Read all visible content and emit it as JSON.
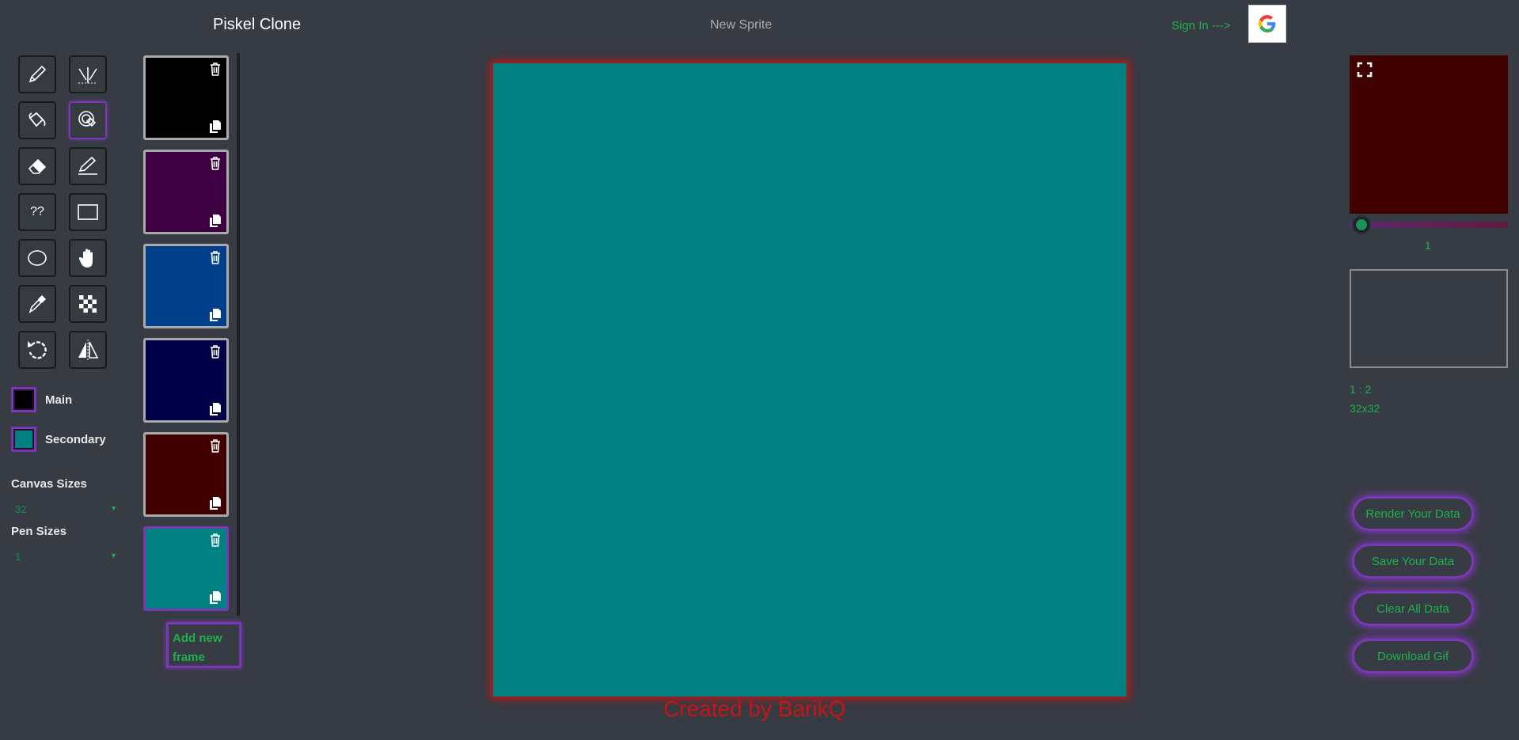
{
  "header": {
    "app_title": "Piskel Clone",
    "sprite_name": "New Sprite",
    "sign_in_label": "Sign In --->"
  },
  "tools": [
    {
      "name": "pen-tool",
      "icon": "pencil-icon"
    },
    {
      "name": "vertical-mirror-pen-tool",
      "icon": "mirror-pen-icon"
    },
    {
      "name": "paint-bucket-tool",
      "icon": "bucket-icon"
    },
    {
      "name": "paint-same-pixels-tool",
      "icon": "magic-bucket-icon"
    },
    {
      "name": "eraser-tool",
      "icon": "eraser-icon"
    },
    {
      "name": "stroke-tool",
      "icon": "stroke-pen-icon"
    },
    {
      "name": "unknown-tool",
      "icon": "question-text",
      "text": "??"
    },
    {
      "name": "rectangle-tool",
      "icon": "rectangle-icon"
    },
    {
      "name": "circle-tool",
      "icon": "ellipse-icon"
    },
    {
      "name": "move-tool",
      "icon": "hand-icon"
    },
    {
      "name": "color-picker-tool",
      "icon": "eyedropper-icon"
    },
    {
      "name": "dithering-tool",
      "icon": "checker-icon"
    },
    {
      "name": "rotate-tool",
      "icon": "rotate-icon"
    },
    {
      "name": "flip-tool",
      "icon": "flip-icon"
    }
  ],
  "colors": {
    "main_label": "Main",
    "secondary_label": "Secondary",
    "main_color": "#000000",
    "secondary_color": "#008080"
  },
  "canvas_sizes": {
    "label": "Canvas Sizes",
    "selected": "32"
  },
  "pen_sizes": {
    "label": "Pen Sizes",
    "selected": "1"
  },
  "frames": [
    {
      "color": "#000000"
    },
    {
      "color": "#3d0040"
    },
    {
      "color": "#00408a"
    },
    {
      "color": "#000046"
    },
    {
      "color": "#400000"
    },
    {
      "color": "#008080",
      "active": true
    }
  ],
  "add_frame_label": "Add new frame",
  "canvas": {
    "fill_color": "#008080"
  },
  "footer_text": "Created by BarikQ",
  "preview": {
    "fill_color": "#400000",
    "fps_value": "1",
    "zoom_info": "1 : 2",
    "size_info": "32x32"
  },
  "actions": {
    "render_label": "Render Your Data",
    "save_label": "Save Your Data",
    "clear_label": "Clear All Data",
    "download_label": "Download Gif"
  }
}
